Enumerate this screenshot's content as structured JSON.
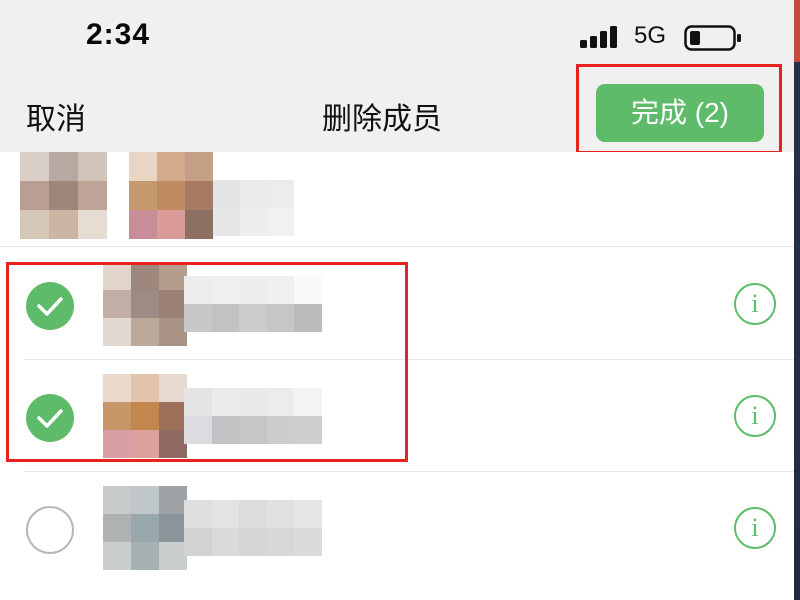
{
  "status_bar": {
    "time": "2:34",
    "network": "5G",
    "signal_icon": "cellular-signal-icon",
    "battery_icon": "battery-low-icon",
    "battery_level": 0.2
  },
  "nav": {
    "cancel_label": "取消",
    "title": "删除成员",
    "done_label": "完成 (2)"
  },
  "members": [
    {
      "selected": true,
      "check_icon": "checkmark-circle-icon",
      "info_icon": "info-icon",
      "info_symbol": "i"
    },
    {
      "selected": true,
      "check_icon": "checkmark-circle-icon",
      "info_icon": "info-icon",
      "info_symbol": "i"
    },
    {
      "selected": false,
      "check_icon": "empty-circle-icon",
      "info_icon": "info-icon",
      "info_symbol": "i"
    }
  ],
  "colors": {
    "accent_green": "#5dbb69",
    "annotation_red": "#e8221e",
    "bar_background": "#f0f0f0"
  }
}
